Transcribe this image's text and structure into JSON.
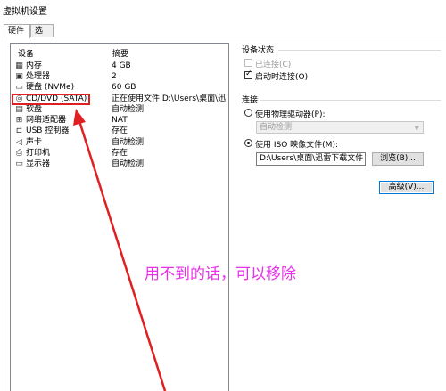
{
  "window": {
    "title": "虚拟机设置"
  },
  "tabs": [
    {
      "label": "硬件",
      "active": true
    },
    {
      "label": "选项",
      "active": false
    }
  ],
  "device_list": {
    "headers": {
      "device": "设备",
      "summary": "摘要"
    },
    "rows": [
      {
        "icon": "memory-icon",
        "glyph": "▦",
        "name": "内存",
        "summary": "4 GB"
      },
      {
        "icon": "cpu-icon",
        "glyph": "▣",
        "name": "处理器",
        "summary": "2"
      },
      {
        "icon": "disk-icon",
        "glyph": "▭",
        "name": "硬盘 (NVMe)",
        "summary": "60 GB"
      },
      {
        "icon": "cd-icon",
        "glyph": "◎",
        "name": "CD/DVD (SATA)",
        "summary": "正在使用文件 D:\\Users\\桌面\\迅..."
      },
      {
        "icon": "floppy-icon",
        "glyph": "▤",
        "name": "软盘",
        "summary": "自动检测"
      },
      {
        "icon": "network-icon",
        "glyph": "⊞",
        "name": "网络适配器",
        "summary": "NAT"
      },
      {
        "icon": "usb-icon",
        "glyph": "⊏",
        "name": "USB 控制器",
        "summary": "存在"
      },
      {
        "icon": "sound-icon",
        "glyph": "◁",
        "name": "声卡",
        "summary": "自动检测"
      },
      {
        "icon": "printer-icon",
        "glyph": "⎙",
        "name": "打印机",
        "summary": "存在"
      },
      {
        "icon": "display-icon",
        "glyph": "▭",
        "name": "显示器",
        "summary": "自动检测"
      }
    ]
  },
  "device_status": {
    "group_label": "设备状态",
    "connected_label": "已连接(C)",
    "connected_checked": false,
    "connected_disabled": true,
    "connect_on_start_label": "启动时连接(O)",
    "connect_on_start_checked": true
  },
  "connection": {
    "group_label": "连接",
    "physical_drive_label": "使用物理驱动器(P):",
    "physical_drive_selected": false,
    "physical_drive_value": "自动检测",
    "iso_label": "使用 ISO 映像文件(M):",
    "iso_selected": true,
    "iso_path": "D:\\Users\\桌面\\迅雷下载文件",
    "browse_label": "浏览(B)..."
  },
  "advanced_label": "高级(V)...",
  "annotation": {
    "text": "用不到的话，可以移除",
    "color": "#e830e8",
    "arrow_color": "#e02020"
  }
}
